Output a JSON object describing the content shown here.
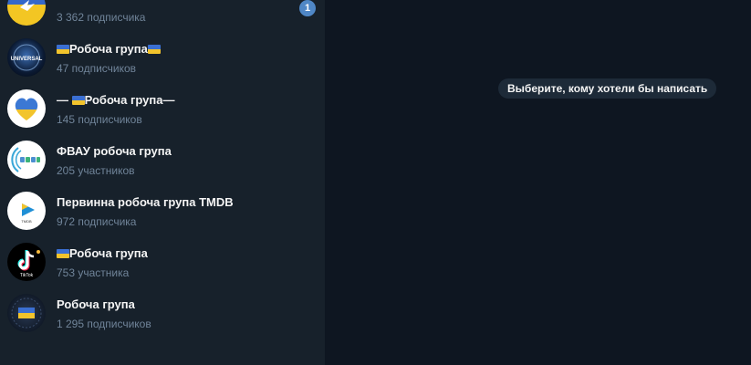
{
  "sidebar": {
    "chats": [
      {
        "title": "",
        "subtitle": "3 362 подписчика",
        "unread": "1"
      },
      {
        "title": "Робоча група",
        "subtitle": "47 подписчиков"
      },
      {
        "title_prefix": "—",
        "title": "Робоча група—",
        "subtitle": "145 подписчиков"
      },
      {
        "title": "ФВАУ робоча група",
        "subtitle": "205 участников"
      },
      {
        "title": "Первинна робоча група TMDB",
        "subtitle": "972 подписчика"
      },
      {
        "title": "Робоча група",
        "subtitle": "753 участника"
      },
      {
        "title": "Робоча група",
        "subtitle": "1 295 подписчиков"
      }
    ],
    "avatar_text": {
      "universal": "UNIVERSAL",
      "tiktok": "TikTok",
      "tmdb": "TMDB"
    }
  },
  "main": {
    "empty_state_message": "Выберите, кому хотели бы написать"
  },
  "colors": {
    "sidebar_bg": "#17212b",
    "main_bg": "#0e1621",
    "accent": "#4f87c6"
  }
}
